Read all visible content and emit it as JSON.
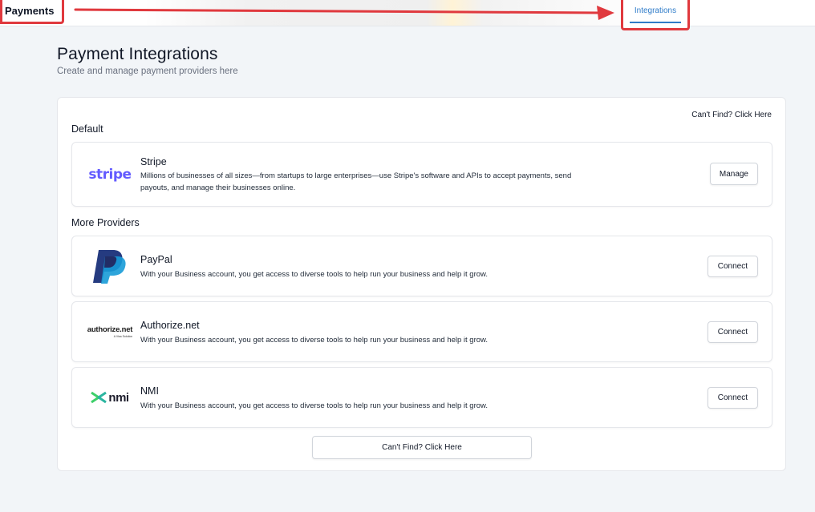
{
  "topbar": {
    "payments_label": "Payments",
    "integrations_tab_label": "Integrations"
  },
  "header": {
    "title": "Payment Integrations",
    "subtitle": "Create and manage payment providers here"
  },
  "main": {
    "cant_find_link": "Can't Find? Click Here",
    "default_section_label": "Default",
    "more_section_label": "More Providers",
    "bottom_cta": "Can't Find? Click Here",
    "default_provider": {
      "logo_text": "stripe",
      "name": "Stripe",
      "description": "Millions of businesses of all sizes—from startups to large enterprises—use Stripe's software and APIs to accept payments, send payouts, and manage their businesses online.",
      "button": "Manage"
    },
    "providers": [
      {
        "name": "PayPal",
        "description": "With your Business account, you get access to diverse tools to help run your business and help it grow.",
        "button": "Connect",
        "logo_icon": "paypal-logo-icon"
      },
      {
        "name": "Authorize.net",
        "logo_text": "authorize.net",
        "logo_subtext": "A Visa Solution",
        "description": "With your Business account, you get access to diverse tools to help run your business and help it grow.",
        "button": "Connect"
      },
      {
        "name": "NMI",
        "logo_text": "nmi",
        "description": "With your Business account, you get access to diverse tools to help run your business and help it grow.",
        "button": "Connect"
      }
    ]
  },
  "colors": {
    "annotation_red": "#e0393e",
    "tab_blue": "#2f7cc9",
    "stripe_purple": "#635bff",
    "paypal_dark": "#253b80",
    "paypal_light": "#179bd7",
    "nmi_green": "#3ecf6a"
  }
}
